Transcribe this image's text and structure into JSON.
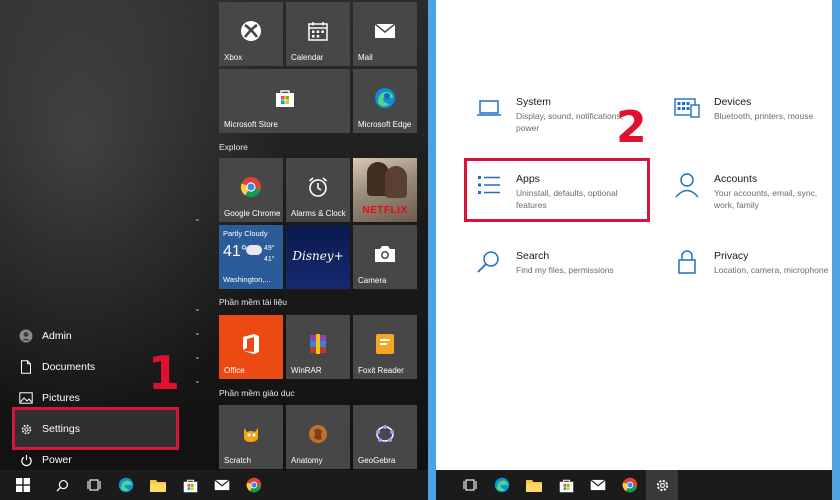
{
  "start_menu": {
    "rail": [
      {
        "label": "Admin",
        "icon": "user-avatar-icon"
      },
      {
        "label": "Documents",
        "icon": "document-icon"
      },
      {
        "label": "Pictures",
        "icon": "pictures-icon"
      },
      {
        "label": "Settings",
        "icon": "gear-icon"
      },
      {
        "label": "Power",
        "icon": "power-icon"
      }
    ],
    "step_number": "1",
    "groups": {
      "explore": "Explore",
      "documents": "Phần mềm tài liệu",
      "education": "Phần mềm giáo dục"
    },
    "tiles": {
      "xbox": "Xbox",
      "calendar": "Calendar",
      "mail": "Mail",
      "store": "Microsoft Store",
      "edge": "Microsoft Edge",
      "chrome": "Google Chrome",
      "alarms": "Alarms & Clock",
      "netflix": "NETFLIX",
      "camera": "Camera",
      "office": "Office",
      "winrar": "WinRAR",
      "foxit": "Foxit Reader",
      "scratch": "Scratch",
      "anatomy": "Anatomy",
      "geogebra": "GeoGebra"
    },
    "weather": {
      "condition": "Partly Cloudy",
      "temp": "41°",
      "high": "49°",
      "low": "41°",
      "location": "Washington,..."
    },
    "disney": "Disney+"
  },
  "settings": {
    "step_number": "2",
    "categories": [
      {
        "title": "System",
        "desc": "Display, sound, notifications, power",
        "icon": "laptop-icon"
      },
      {
        "title": "Devices",
        "desc": "Bluetooth, printers, mouse",
        "icon": "keyboard-icon"
      },
      {
        "title": "Apps",
        "desc": "Uninstall, defaults, optional features",
        "icon": "apps-list-icon"
      },
      {
        "title": "Accounts",
        "desc": "Your accounts, email, sync, work, family",
        "icon": "person-icon"
      },
      {
        "title": "Search",
        "desc": "Find my files, permissions",
        "icon": "search-icon"
      },
      {
        "title": "Privacy",
        "desc": "Location, camera, microphone",
        "icon": "lock-icon"
      }
    ]
  },
  "colors": {
    "highlight_red": "#d7153a",
    "accent_blue": "#1f6fc5",
    "office_orange": "#eb4a12"
  }
}
